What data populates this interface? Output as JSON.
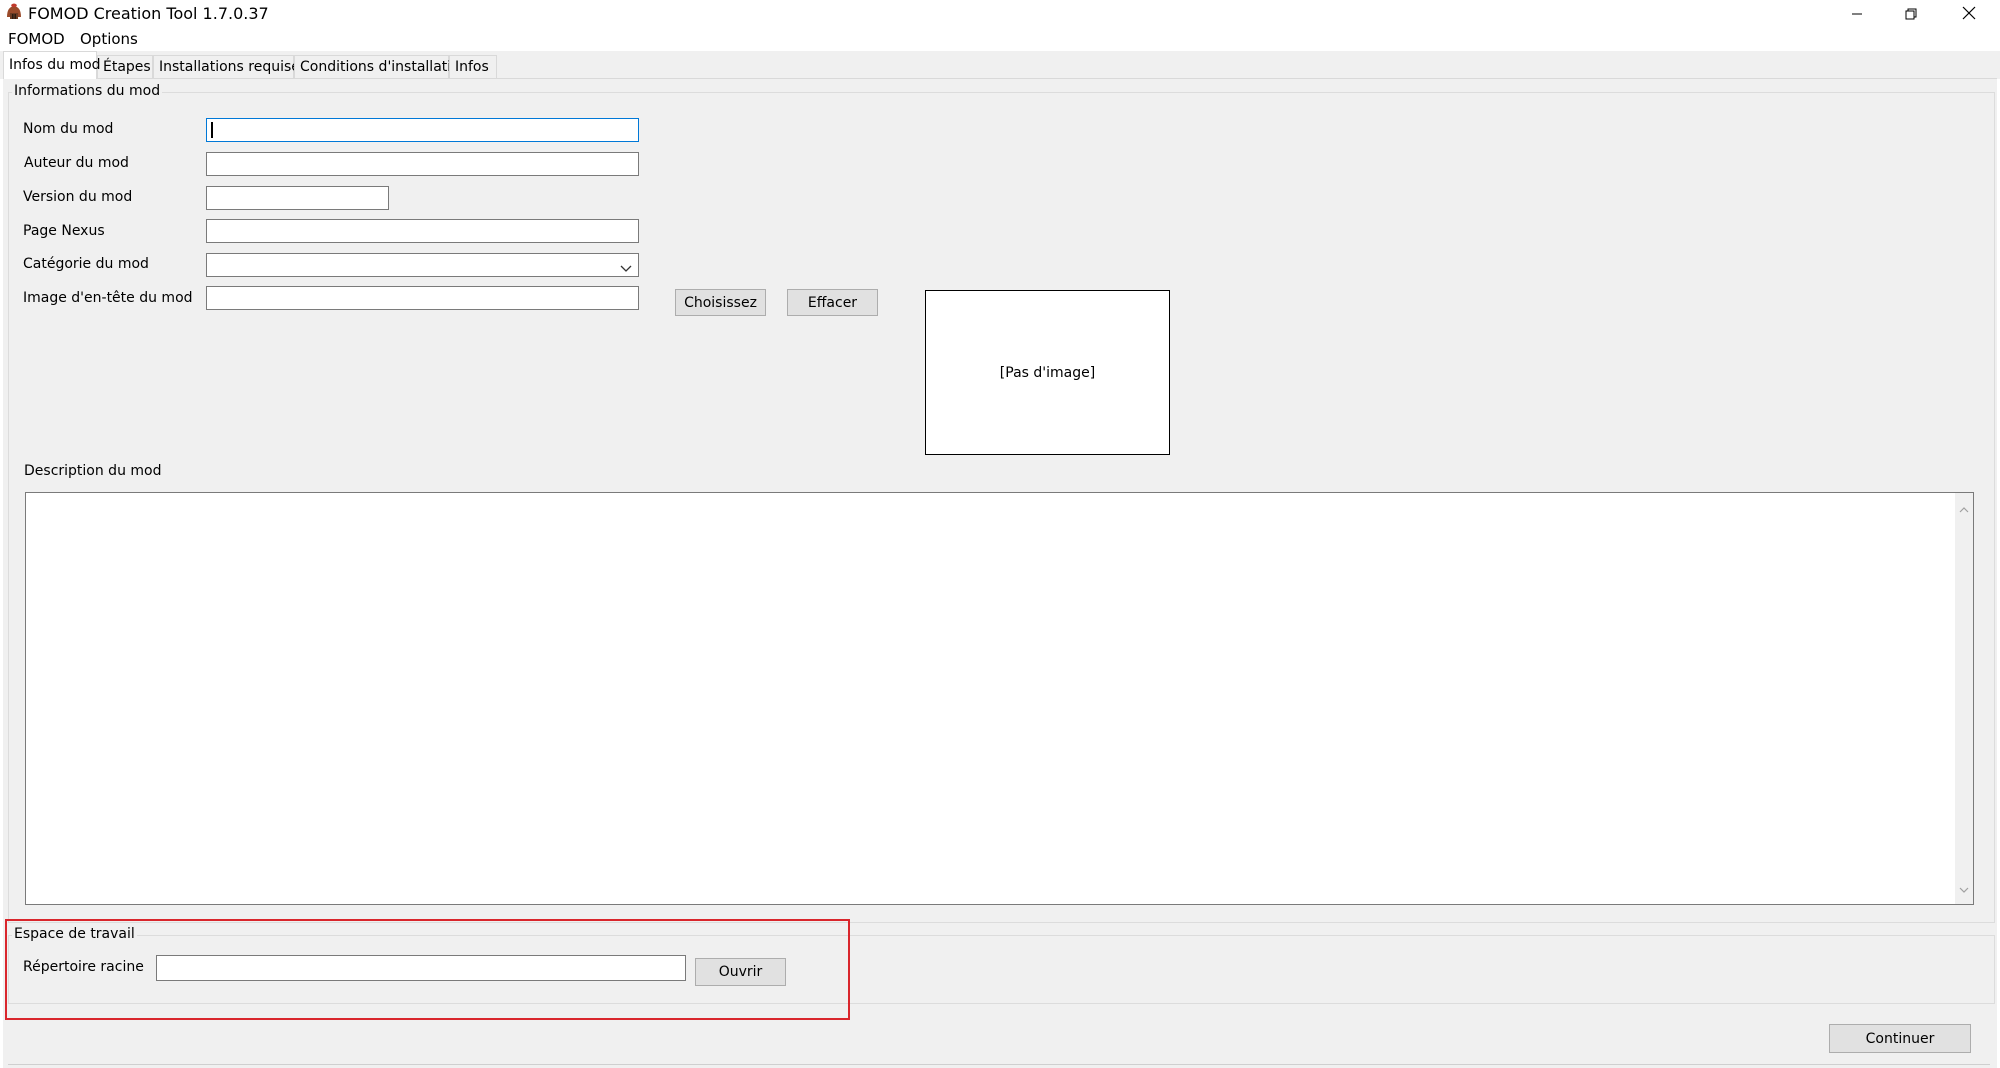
{
  "window": {
    "title": "FOMOD Creation Tool 1.7.0.37",
    "icon": "helmet-app-icon",
    "controls": [
      "minimize-icon",
      "restore-icon",
      "close-icon"
    ]
  },
  "menu": {
    "items": [
      "FOMOD",
      "Options"
    ]
  },
  "tabs": [
    "Infos du mod",
    "Étapes",
    "Installations requises",
    "Conditions d'installation",
    "Infos"
  ],
  "mod_info": {
    "legend": "Informations du mod",
    "name_label": "Nom du mod",
    "author_label": "Auteur du mod",
    "version_label": "Version du mod",
    "nexus_label": "Page Nexus",
    "category_label": "Catégorie du mod",
    "header_image_label": "Image d'en-tête du mod",
    "choose_button": "Choisissez",
    "clear_button": "Effacer",
    "no_image": "[Pas d'image]",
    "description_label": "Description du mod"
  },
  "workspace": {
    "legend": "Espace de travail",
    "root_label": "Répertoire racine",
    "open_button": "Ouvrir"
  },
  "footer": {
    "continue_button": "Continuer"
  },
  "colors": {
    "highlight": "#d9262c",
    "focus": "#0078d7"
  }
}
